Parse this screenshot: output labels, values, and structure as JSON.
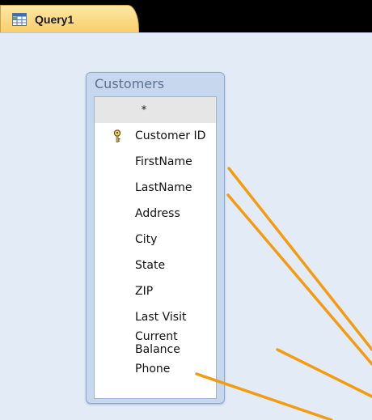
{
  "tab": {
    "label": "Query1",
    "icon": "query-grid-icon"
  },
  "field_list": {
    "title": "Customers",
    "star": "*",
    "fields": [
      {
        "label": "Customer ID",
        "primary_key": true
      },
      {
        "label": "FirstName"
      },
      {
        "label": "LastName"
      },
      {
        "label": "Address"
      },
      {
        "label": "City"
      },
      {
        "label": "State"
      },
      {
        "label": "ZIP"
      },
      {
        "label": "Last Visit"
      },
      {
        "label": "Current Balance"
      },
      {
        "label": "Phone"
      }
    ]
  },
  "colors": {
    "tab_bg": "#f9cf69",
    "design_bg": "#e2ebf6",
    "callout": "#f39c12"
  }
}
